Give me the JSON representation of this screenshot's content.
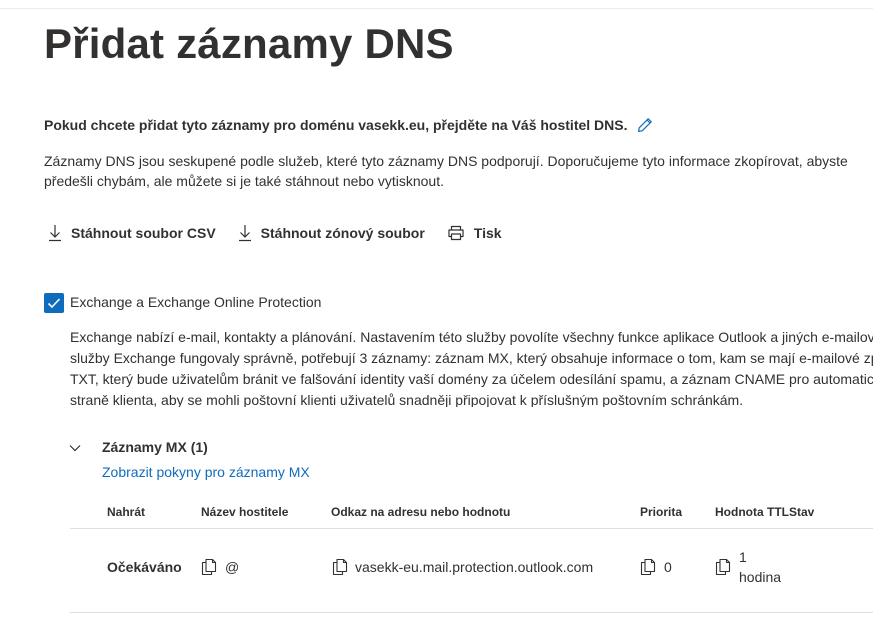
{
  "page": {
    "title": "Přidat záznamy DNS",
    "domain_instruction": "Pokud chcete přidat tyto záznamy pro doménu vasekk.eu, přejděte na Váš hostitel DNS.",
    "intro": "Záznamy DNS jsou seskupené podle služeb, které tyto záznamy DNS podporují. Doporučujeme tyto informace zkopírovat, abyste předešli chybám, ale můžete si je také stáhnout nebo vytisknout."
  },
  "actions": {
    "download_csv": "Stáhnout soubor CSV",
    "download_zone": "Stáhnout zónový soubor",
    "print": "Tisk"
  },
  "service": {
    "checked": true,
    "label": "Exchange a Exchange Online Protection",
    "description_lines": [
      "Exchange nabízí e-mail, kontakty a plánování. Nastavením této služby povolíte všechny funkce aplikace Outlook a jiných e-mailových",
      "služby Exchange fungovaly správně, potřebují 3 záznamy: záznam MX, který obsahuje informace o tom, kam se mají e-mailové zprávy",
      "TXT, který bude uživatelům bránit ve falšování identity vaší domény za účelem odesílání spamu, a záznam CNAME pro automatickou",
      "straně klienta, aby se mohli poštovní klienti uživatelů snadněji připojovat k příslušným poštovním schránkám."
    ]
  },
  "mx_section": {
    "title": "Záznamy MX (1)",
    "link": "Zobrazit pokyny pro záznamy MX",
    "columns": {
      "upload": "Nahrát",
      "hostname": "Název hostitele",
      "points_to": "Odkaz na adresu nebo hodnotu",
      "priority": "Priorita",
      "ttl": "Hodnota TTL",
      "status": "Stav"
    },
    "rows": [
      {
        "upload": "Očekáváno",
        "hostname": "@",
        "points_to": "vasekk-eu.mail.protection.outlook.com",
        "priority": "0",
        "ttl_line1": "1",
        "ttl_line2": "hodina"
      }
    ]
  },
  "colors": {
    "accent": "#0f6cbd",
    "text": "#323130",
    "rule": "#e1dfdd"
  },
  "icons": [
    "edit-pencil-icon",
    "download-icon",
    "print-icon",
    "checkbox-checkmark-icon",
    "chevron-down-icon",
    "copy-icon"
  ]
}
